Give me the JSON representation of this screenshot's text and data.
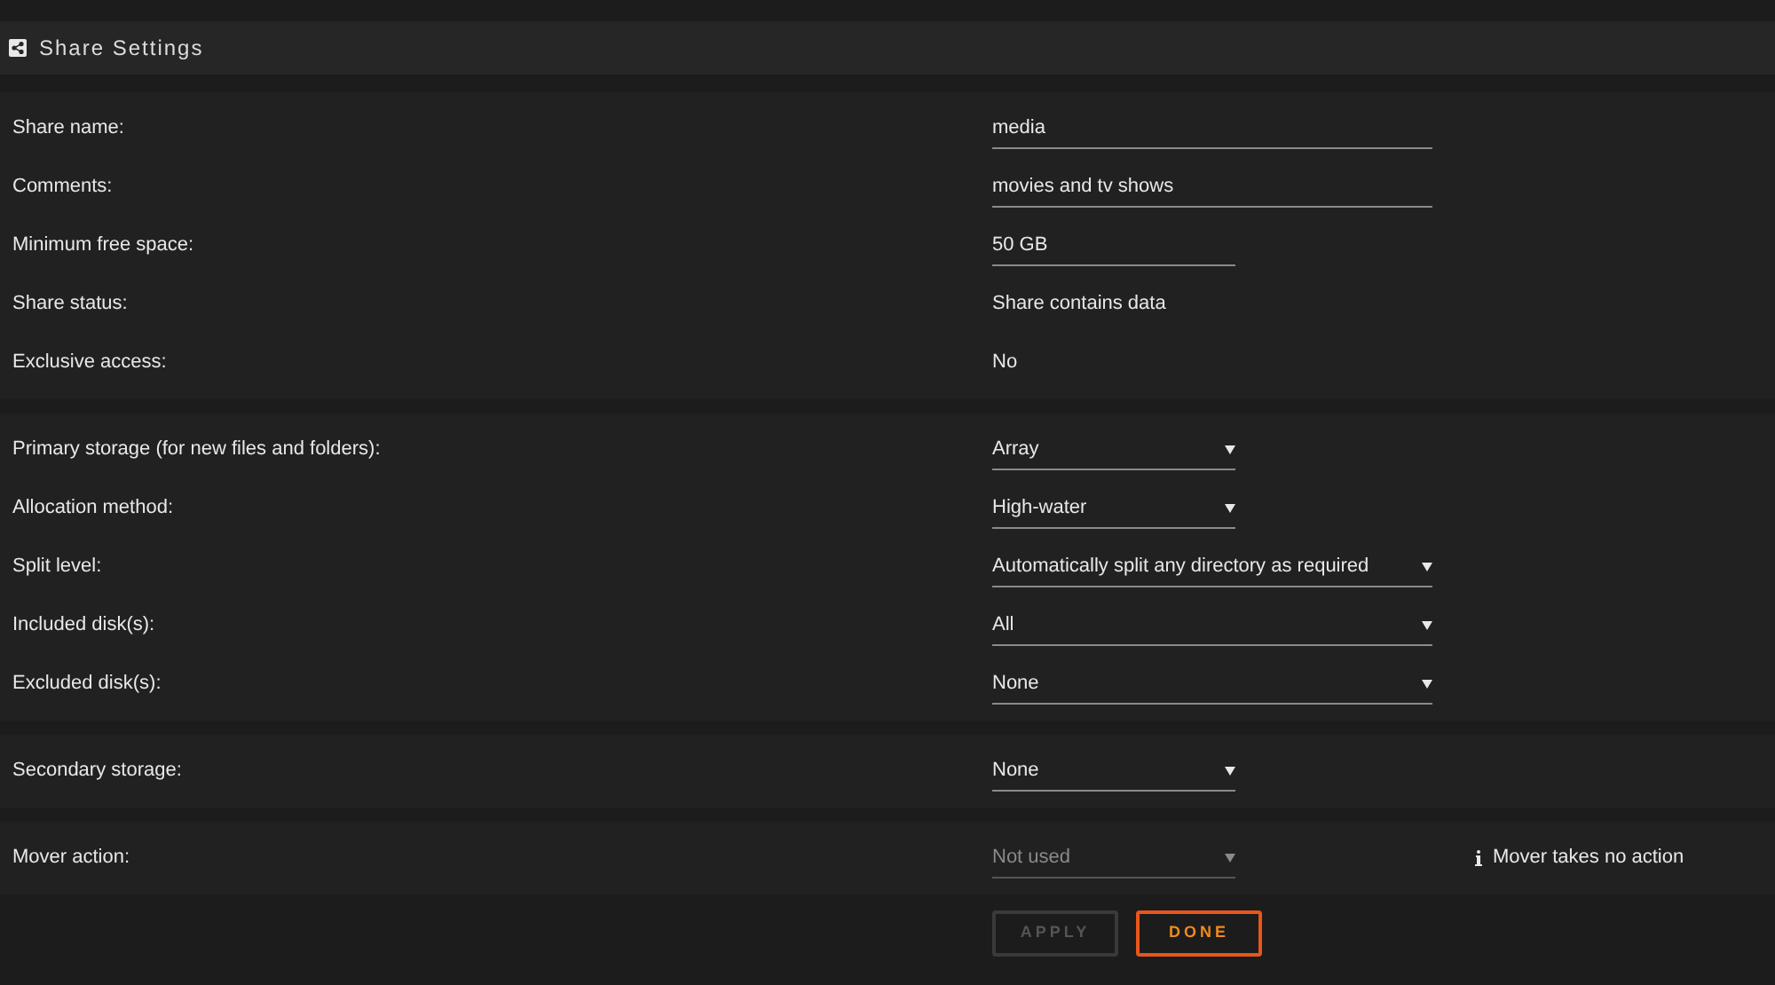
{
  "title": "Share Settings",
  "sections": [
    {
      "rows": [
        {
          "label": "Share name:",
          "kind": "text",
          "value": "media",
          "wide": true
        },
        {
          "label": "Comments:",
          "kind": "text",
          "value": "movies and tv shows",
          "wide": true
        },
        {
          "label": "Minimum free space:",
          "kind": "text",
          "value": "50 GB",
          "wide": false
        },
        {
          "label": "Share status:",
          "kind": "static",
          "value": "Share contains data"
        },
        {
          "label": "Exclusive access:",
          "kind": "static",
          "value": "No"
        }
      ]
    },
    {
      "rows": [
        {
          "label": "Primary storage (for new files and folders):",
          "kind": "select",
          "value": "Array",
          "wide": false,
          "disabled": false
        },
        {
          "label": "Allocation method:",
          "kind": "select",
          "value": "High-water",
          "wide": false,
          "disabled": false
        },
        {
          "label": "Split level:",
          "kind": "select",
          "value": "Automatically split any directory as required",
          "wide": true,
          "disabled": false
        },
        {
          "label": "Included disk(s):",
          "kind": "select",
          "value": "All",
          "wide": true,
          "disabled": false
        },
        {
          "label": "Excluded disk(s):",
          "kind": "select",
          "value": "None",
          "wide": true,
          "disabled": false
        }
      ]
    },
    {
      "rows": [
        {
          "label": "Secondary storage:",
          "kind": "select",
          "value": "None",
          "wide": false,
          "disabled": false
        }
      ]
    },
    {
      "rows": [
        {
          "label": "Mover action:",
          "kind": "select",
          "value": "Not used",
          "wide": false,
          "disabled": true,
          "note": "Mover takes no action"
        }
      ]
    }
  ],
  "buttons": [
    {
      "label": "APPLY",
      "disabled": true
    },
    {
      "label": "DONE",
      "disabled": false
    }
  ]
}
